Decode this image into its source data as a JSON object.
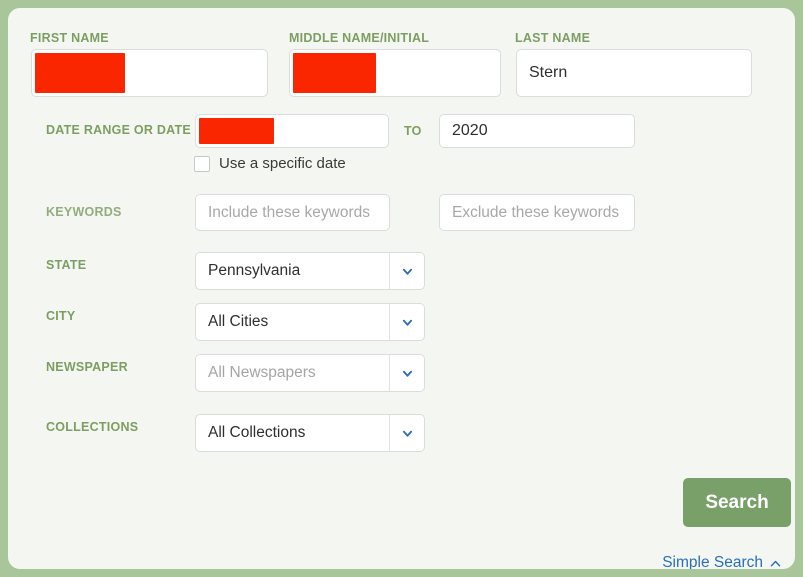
{
  "theme": {
    "frame_color": "#a9c69b",
    "panel_color": "#f4f7f1",
    "label_green": "#7d9e62",
    "button_green": "#79a068",
    "link_blue": "#2a6ebb",
    "chevron_blue": "#2c6bbd",
    "redaction_red": "#fa2600"
  },
  "form": {
    "first_name": {
      "label": "FIRST NAME",
      "value": "",
      "redacted": true
    },
    "middle_name": {
      "label": "MIDDLE NAME/INITIAL",
      "value": "",
      "redacted": true
    },
    "last_name": {
      "label": "LAST NAME",
      "value": "Stern"
    },
    "date_range": {
      "label": "DATE RANGE OR DATE",
      "from_value": "",
      "from_redacted": true,
      "to_label": "TO",
      "to_value": "2020"
    },
    "specific_date": {
      "label": "Use a specific date",
      "checked": false
    },
    "keywords": {
      "label": "KEYWORDS",
      "include_placeholder": "Include these keywords",
      "include_value": "",
      "exclude_placeholder": "Exclude these keywords",
      "exclude_value": ""
    },
    "state": {
      "label": "STATE",
      "value": "Pennsylvania",
      "disabled": false
    },
    "city": {
      "label": "CITY",
      "value": "All Cities",
      "disabled": false
    },
    "newspaper": {
      "label": "NEWSPAPER",
      "value": "All Newspapers",
      "disabled": true
    },
    "collections": {
      "label": "COLLECTIONS",
      "value": "All Collections",
      "disabled": false
    }
  },
  "actions": {
    "search_label": "Search",
    "simple_search_label": "Simple Search"
  },
  "icons": {
    "chevron_down": "chevron-down-icon",
    "chevron_up": "chevron-up-icon"
  }
}
